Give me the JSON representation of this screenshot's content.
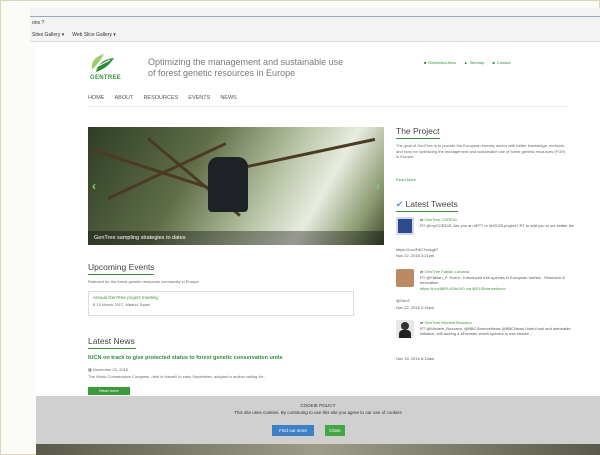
{
  "browser": {
    "menu_label": "ons ?",
    "favorites": [
      "Sites Gallery ▾",
      "Web Slice Gallery ▾"
    ]
  },
  "header": {
    "logo_text": "GENTREE",
    "tagline": "Optimizing the management and sustainable use of forest genetic resources in Europe",
    "links": [
      "Restricted Area",
      "Sitemap",
      "Contact"
    ]
  },
  "nav": {
    "items": [
      "HOME",
      "ABOUT",
      "RESOURCES",
      "EVENTS",
      "NEWS"
    ]
  },
  "hero": {
    "caption": "GenTree sampling strategies to dates",
    "prev_arrow": "‹",
    "next_arrow": "›"
  },
  "events": {
    "title": "Upcoming Events",
    "intro": "Relevant for the forest genetic resources community in Europe",
    "event_title": "Annual GenTree project meeting",
    "event_date": "6-10 March 2017, Madrid, Spain"
  },
  "news": {
    "title": "Latest News",
    "headline": "IUCN on track to give protected status to forest genetic conservation units",
    "date": "November 03, 2016",
    "summary": "The World Conservation Congress, held in Hawai‘i in early September, adopted a motion calling for...",
    "button": "Read more"
  },
  "project": {
    "title": "The Project",
    "text": "The goal of GenTree is to provide the European forestry sector with better knowledge, methods and tools for optimizing the management and sustainable use of forest genetic resources (FGR) in Europe.",
    "read_more": "Read More"
  },
  "tweets": {
    "title": "Latest Tweets",
    "items": [
      {
        "handle": "GenTree",
        "name": "COREAL",
        "text": "RT @myCORDIS: Are you an #FP7 or #H2020 project? RT to add you to our twitter list",
        "link": "https://t.co/FdC7exkgkT",
        "date": "Nov 22, 2016 3:21pm"
      },
      {
        "handle": "GenTree",
        "name": "Fabian Lorzana",
        "text": "RT @Fabian_F: Event - Introduced tree species in European forests - Research & Innovation",
        "link": "https://t.co/6BPL6GbUV0 via @EUScienceInnov",
        "extra": "@GenT",
        "date": "Nov 22, 2016 2:16pm"
      },
      {
        "handle": "GenTree",
        "name": "Michele Bozzano",
        "text": "RT @Michele_Bozzano: @BBCScienceNews @BBCNews Useful tool and admirable initiative, still lacking a #Forester which species to use should...",
        "date": "Nov 15, 2016 8:13am"
      }
    ]
  },
  "cookie": {
    "title": "COOKIE POLICY",
    "message": "This site uses cookies. By continuing to use this site you agree to our use of cookies",
    "find_out_more": "Find out more",
    "close": "Close"
  },
  "colors": {
    "brand_green": "#3c8f3c",
    "find_out_more_blue": "#3d80c5",
    "close_green": "#46a546"
  }
}
